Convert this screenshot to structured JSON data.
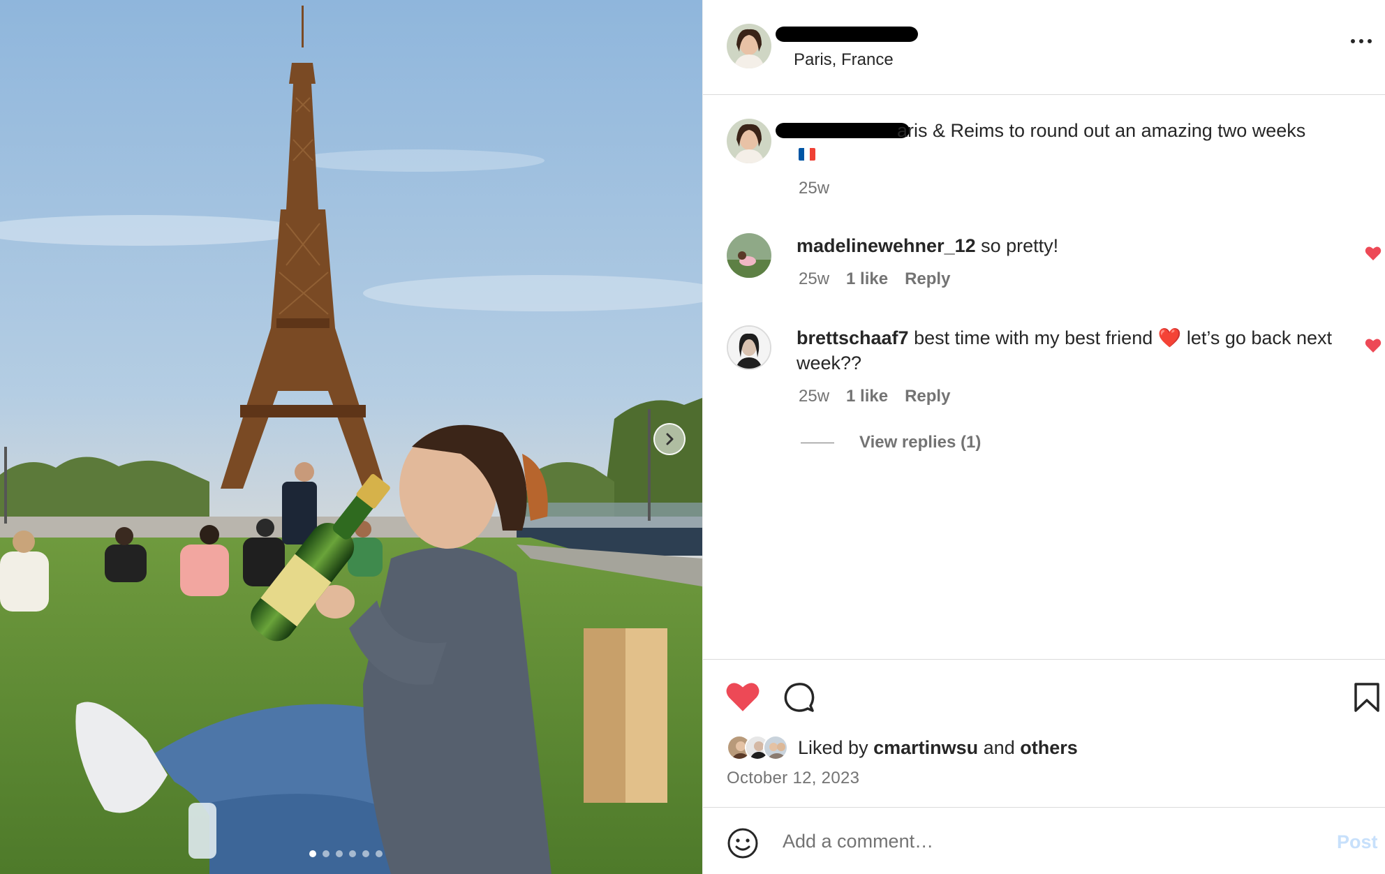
{
  "photo": {
    "description_icon": "post-photo",
    "carousel": {
      "total": 6,
      "active_index": 0
    },
    "next_icon": "chevron-right-icon"
  },
  "header": {
    "location": "Paris, France",
    "more_icon": "more-options-icon"
  },
  "caption": {
    "text": "aris & Reims to round out an amazing two weeks",
    "flag": "🇫🇷",
    "time": "25w"
  },
  "comments": [
    {
      "username": "madelinewehner_12",
      "text": "so pretty!",
      "time": "25w",
      "likes": "1 like",
      "reply": "Reply"
    },
    {
      "username": "brettschaaf7",
      "text": "best time with my best friend ❤️ let’s go back next week??",
      "time": "25w",
      "likes": "1 like",
      "reply": "Reply"
    }
  ],
  "view_replies": "View replies (1)",
  "actions": {
    "like_icon": "heart-filled-icon",
    "comment_icon": "comment-icon",
    "save_icon": "bookmark-icon",
    "liked_prefix": "Liked by",
    "liked_user": "cmartinwsu",
    "liked_and": "and",
    "liked_others": "others",
    "date": "October 12, 2023"
  },
  "comment_box": {
    "emoji_icon": "emoji-icon",
    "placeholder": "Add a comment…",
    "post_label": "Post"
  },
  "colors": {
    "heart_red": "#ed4956",
    "text": "#262626",
    "secondary": "#737373",
    "post_disabled": "#c7e0fb"
  }
}
